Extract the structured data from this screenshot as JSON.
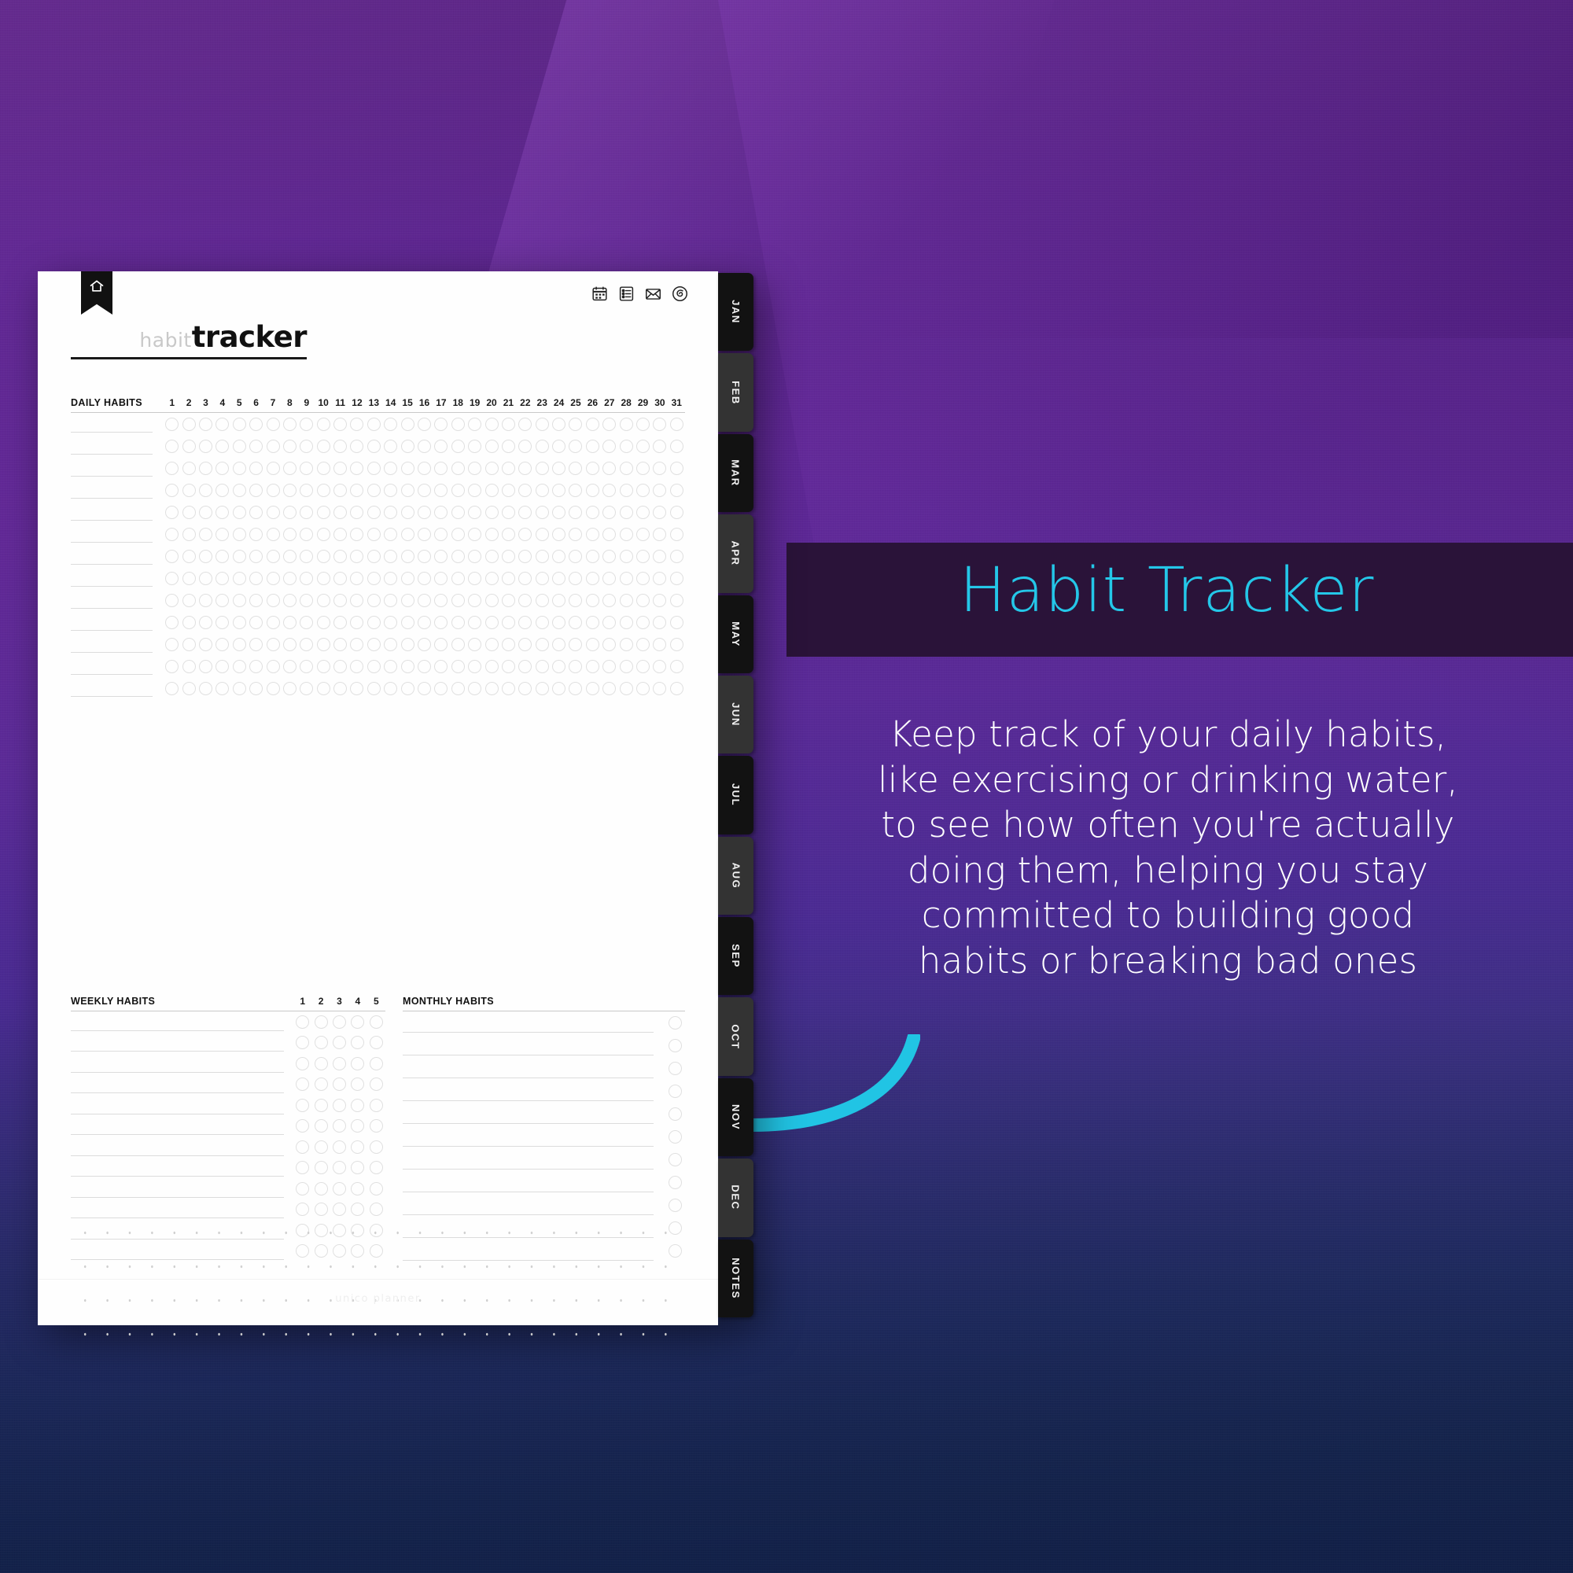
{
  "promo": {
    "title": "Habit Tracker",
    "body_lines": [
      "Keep track of your daily habits,",
      "like exercising or drinking water,",
      "to see how often you're actually",
      "doing them, helping you stay",
      "committed to building good",
      "habits or breaking bad ones"
    ],
    "title_color": "#24c7e8",
    "band_color": "#2a1339",
    "arrow_color": "#21c4e4"
  },
  "planner": {
    "title_light": "habit",
    "title_bold": "tracker",
    "bookmark_icon": "home-icon",
    "top_icons": [
      "calendar-icon",
      "checklist-icon",
      "envelope-icon",
      "spiral-icon"
    ],
    "footer": "unico planner",
    "daily": {
      "label": "DAILY HABITS",
      "day_numbers": [
        1,
        2,
        3,
        4,
        5,
        6,
        7,
        8,
        9,
        10,
        11,
        12,
        13,
        14,
        15,
        16,
        17,
        18,
        19,
        20,
        21,
        22,
        23,
        24,
        25,
        26,
        27,
        28,
        29,
        30,
        31
      ],
      "rows": 13
    },
    "weekly": {
      "label": "WEEKLY HABITS",
      "week_numbers": [
        1,
        2,
        3,
        4,
        5
      ],
      "rows": 12
    },
    "monthly": {
      "label": "MONTHLY HABITS",
      "rows": 11
    },
    "tabs": [
      {
        "label": "JAN",
        "shade": "dark"
      },
      {
        "label": "FEB",
        "shade": "light"
      },
      {
        "label": "MAR",
        "shade": "dark"
      },
      {
        "label": "APR",
        "shade": "light"
      },
      {
        "label": "MAY",
        "shade": "dark"
      },
      {
        "label": "JUN",
        "shade": "light"
      },
      {
        "label": "JUL",
        "shade": "dark"
      },
      {
        "label": "AUG",
        "shade": "light"
      },
      {
        "label": "SEP",
        "shade": "dark"
      },
      {
        "label": "OCT",
        "shade": "light"
      },
      {
        "label": "NOV",
        "shade": "dark"
      },
      {
        "label": "DEC",
        "shade": "light"
      },
      {
        "label": "NOTES",
        "shade": "dark"
      }
    ]
  }
}
